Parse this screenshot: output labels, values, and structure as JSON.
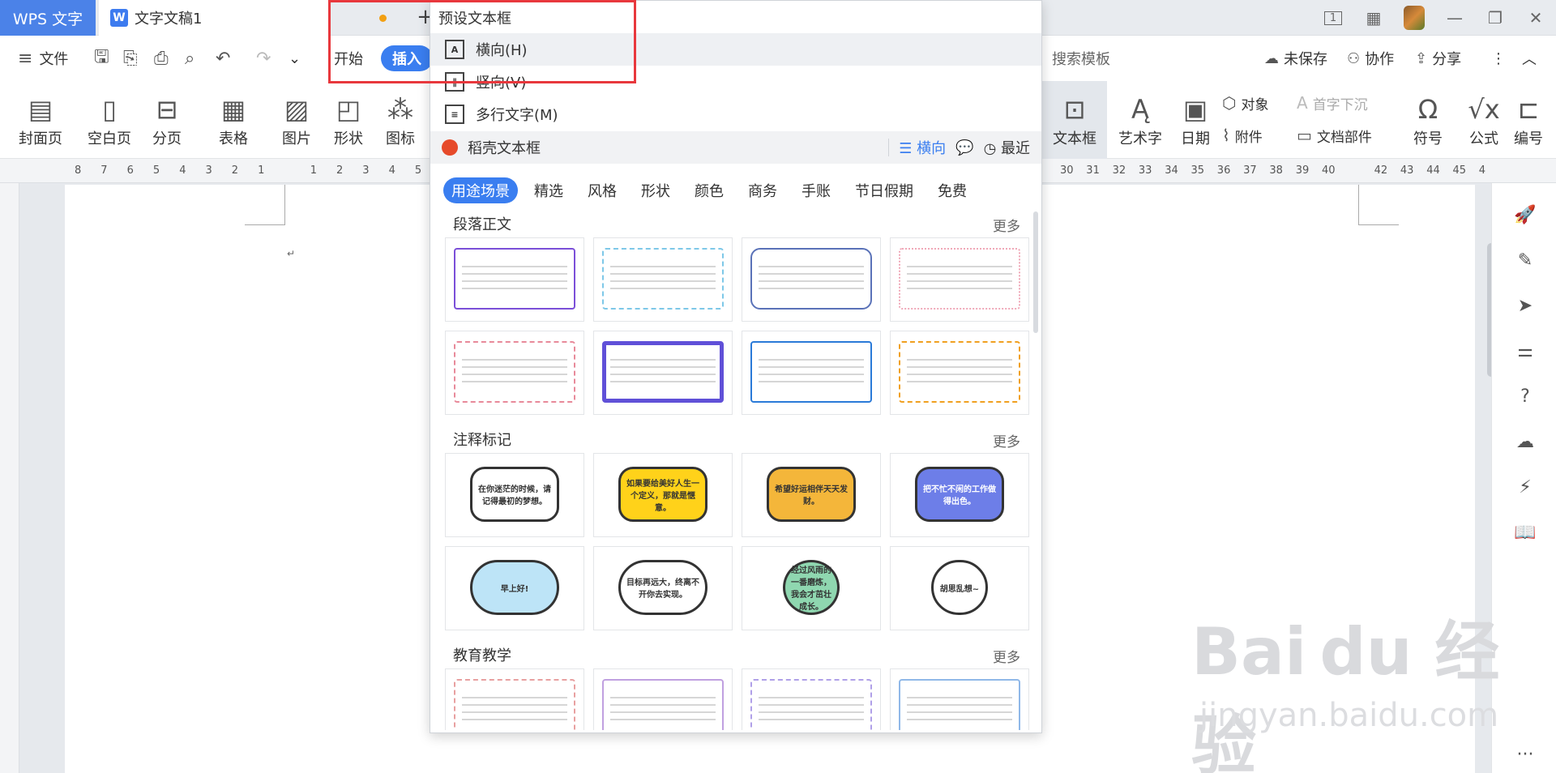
{
  "titlebar": {
    "app_tab": "WPS 文字",
    "doc_tab": "文字文稿1",
    "doc_icon": "W",
    "page_indicator": "1"
  },
  "menubar": {
    "file": "文件",
    "start": "开始",
    "insert": "插入",
    "search_hint": "、搜索模板",
    "unsaved": "未保存",
    "collab": "协作",
    "share": "分享"
  },
  "ribbon": {
    "cover": "封面页",
    "blank": "空白页",
    "pagebreak": "分页",
    "table": "表格",
    "picture": "图片",
    "shape": "形状",
    "icon": "图标",
    "textbox": "文本框",
    "wordart": "艺术字",
    "date": "日期",
    "object": "对象",
    "attach": "附件",
    "dropcap": "首字下沉",
    "docpart": "文档部件",
    "symbol": "符号",
    "formula": "公式",
    "edit": "编号"
  },
  "ruler": {
    "left_nums": [
      "8",
      "7",
      "6",
      "5",
      "4",
      "3",
      "2",
      "1",
      "",
      "1",
      "2",
      "3",
      "4",
      "5"
    ],
    "right_nums": [
      "30",
      "31",
      "32",
      "33",
      "34",
      "35",
      "36",
      "37",
      "38",
      "39",
      "40",
      "",
      "42",
      "43",
      "44",
      "45",
      "4"
    ]
  },
  "dropdown": {
    "header": "预设文本框",
    "items": [
      {
        "label": "横向(H)"
      },
      {
        "label": "竖向(V)"
      },
      {
        "label": "多行文字(M)"
      }
    ],
    "docer_title": "稻壳文本框",
    "orientation": "横向",
    "recent": "最近",
    "filters": [
      "用途场景",
      "精选",
      "风格",
      "形状",
      "颜色",
      "商务",
      "手账",
      "节日假期",
      "免费"
    ],
    "sections": [
      {
        "title": "段落正文",
        "more": "更多"
      },
      {
        "title": "注释标记",
        "more": "更多"
      },
      {
        "title": "教育教学",
        "more": "更多"
      }
    ],
    "bubbles": [
      "在你迷茫的时候，请记得最初的梦想。",
      "如果要给美好人生一个定义，那就是惬意。",
      "希望好运相伴天天发财。",
      "把不忙不闲的工作做得出色。",
      "早上好!",
      "目标再远大，终离不开你去实现。",
      "经过风雨的一番磨炼，我会才茁壮成长。",
      "胡思乱想~"
    ]
  },
  "watermark": {
    "brand": "Bai du 经验",
    "url": "jingyan.baidu.com"
  }
}
